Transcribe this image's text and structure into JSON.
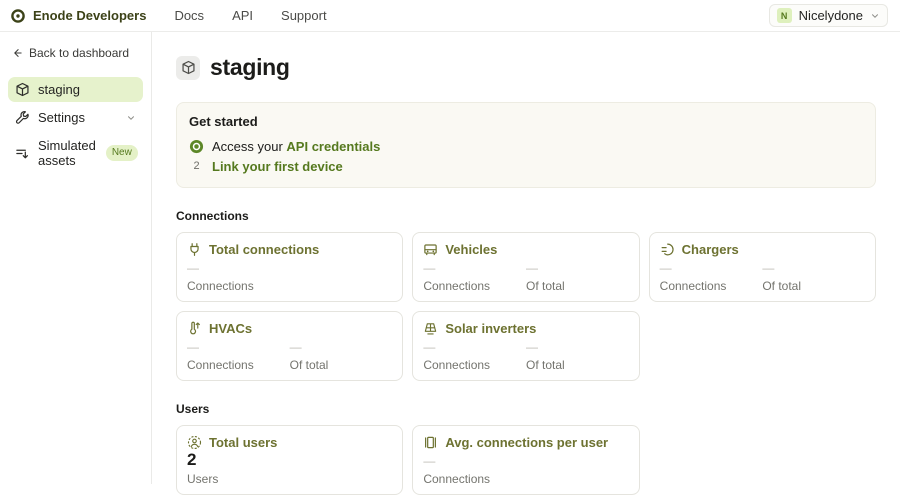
{
  "topbar": {
    "brand": "Enode Developers",
    "nav": [
      {
        "label": "Docs"
      },
      {
        "label": "API"
      },
      {
        "label": "Support"
      }
    ],
    "account": {
      "initial": "N",
      "name": "Nicelydone"
    }
  },
  "sidebar": {
    "back_label": "Back to dashboard",
    "items": [
      {
        "label": "staging",
        "icon": "cube-icon",
        "active": true
      },
      {
        "label": "Settings",
        "icon": "wrench-icon"
      },
      {
        "label": "Simulated assets",
        "icon": "sliders-icon",
        "badge": "New"
      }
    ]
  },
  "page": {
    "title": "staging"
  },
  "get_started": {
    "heading": "Get started",
    "steps": [
      {
        "status": "done",
        "prefix": "Access your ",
        "link": "API credentials"
      },
      {
        "status": "2",
        "step_no": "2",
        "prefix": "",
        "link": "Link your first device"
      }
    ]
  },
  "sections": [
    {
      "heading": "Connections",
      "cards": [
        {
          "title": "Total connections",
          "icon": "plug-icon",
          "stats": [
            {
              "value": "—",
              "label": "Connections"
            }
          ]
        },
        {
          "title": "Vehicles",
          "icon": "car-icon",
          "stats": [
            {
              "value": "—",
              "label": "Connections"
            },
            {
              "value": "—",
              "label": "Of total"
            }
          ]
        },
        {
          "title": "Chargers",
          "icon": "charger-icon",
          "stats": [
            {
              "value": "—",
              "label": "Connections"
            },
            {
              "value": "—",
              "label": "Of total"
            }
          ]
        },
        {
          "title": "HVACs",
          "icon": "thermometer-icon",
          "stats": [
            {
              "value": "—",
              "label": "Connections"
            },
            {
              "value": "—",
              "label": "Of total"
            }
          ]
        },
        {
          "title": "Solar inverters",
          "icon": "solar-panel-icon",
          "stats": [
            {
              "value": "—",
              "label": "Connections"
            },
            {
              "value": "—",
              "label": "Of total"
            }
          ]
        }
      ]
    },
    {
      "heading": "Users",
      "cards": [
        {
          "title": "Total users",
          "icon": "user-icon",
          "stats": [
            {
              "value": "2",
              "label": "Users",
              "big": true
            }
          ]
        },
        {
          "title": "Avg. connections per user",
          "icon": "columns-icon",
          "stats": [
            {
              "value": "—",
              "label": "Connections"
            }
          ]
        }
      ]
    }
  ],
  "colors": {
    "brand_olive": "#3c4218",
    "link_green": "#55791e",
    "card_title_green": "#6d7231",
    "active_pill_bg": "#e6f2cc",
    "panel_bg": "#faf9f3"
  }
}
